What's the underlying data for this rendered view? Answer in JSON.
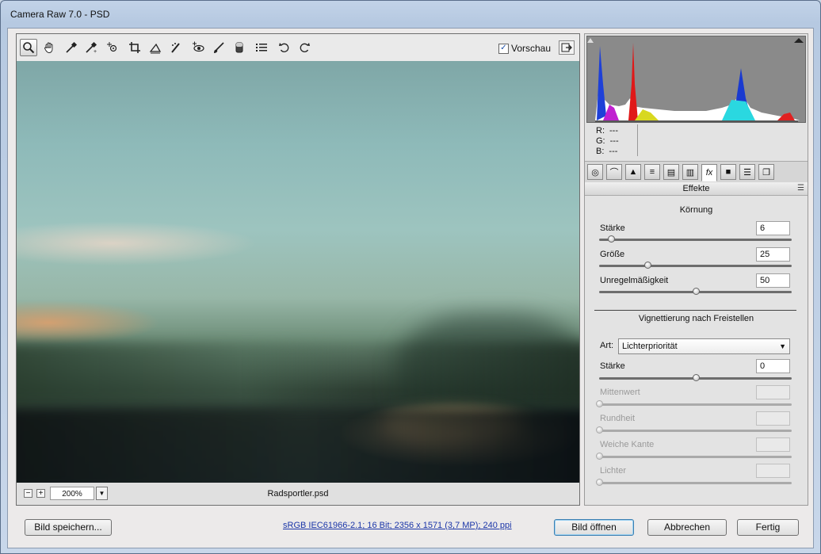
{
  "window": {
    "title": "Camera Raw 7.0 - PSD"
  },
  "toolbar": {
    "tools": [
      "zoom-icon",
      "hand-icon",
      "white-balance-icon",
      "color-sampler-icon",
      "target-adjust-icon",
      "crop-icon",
      "straighten-icon",
      "spot-removal-icon",
      "red-eye-icon",
      "adjustment-brush-icon",
      "graduated-filter-icon",
      "preferences-list-icon",
      "rotate-left-icon",
      "rotate-right-icon"
    ],
    "preview_label": "Vorschau",
    "preview_checked": true
  },
  "statusbar": {
    "zoom": "200%",
    "filename": "Radsportler.psd"
  },
  "readout": {
    "r_label": "R:",
    "r_value": "---",
    "g_label": "G:",
    "g_value": "---",
    "b_label": "B:",
    "b_value": "---"
  },
  "panel": {
    "tabs": [
      "aperture-icon",
      "tone-curve-icon",
      "detail-icon",
      "hsl-icon",
      "split-toning-icon",
      "lens-icon",
      "fx-icon",
      "camera-calibration-icon",
      "presets-icon",
      "snapshots-icon"
    ],
    "active_tab_label": "fx",
    "title": "Effekte",
    "grain": {
      "title": "Körnung",
      "amount_label": "Stärke",
      "amount_value": "6",
      "amount_level": 0.06,
      "size_label": "Größe",
      "size_value": "25",
      "size_level": 0.25,
      "roughness_label": "Unregelmäßigkeit",
      "roughness_value": "50",
      "roughness_level": 0.5
    },
    "vignette": {
      "title": "Vignettierung nach Freistellen",
      "style_label": "Art:",
      "style_value": "Lichterpriorität",
      "amount_label": "Stärke",
      "amount_value": "0",
      "amount_level": 0.5,
      "midpoint_label": "Mittenwert",
      "roundness_label": "Rundheit",
      "feather_label": "Weiche Kante",
      "highlights_label": "Lichter"
    }
  },
  "footer": {
    "save_label": "Bild speichern...",
    "info_link": "sRGB IEC61966-2.1; 16 Bit; 2356 x 1571 (3,7 MP); 240 ppi",
    "open_label": "Bild öffnen",
    "cancel_label": "Abbrechen",
    "done_label": "Fertig"
  }
}
